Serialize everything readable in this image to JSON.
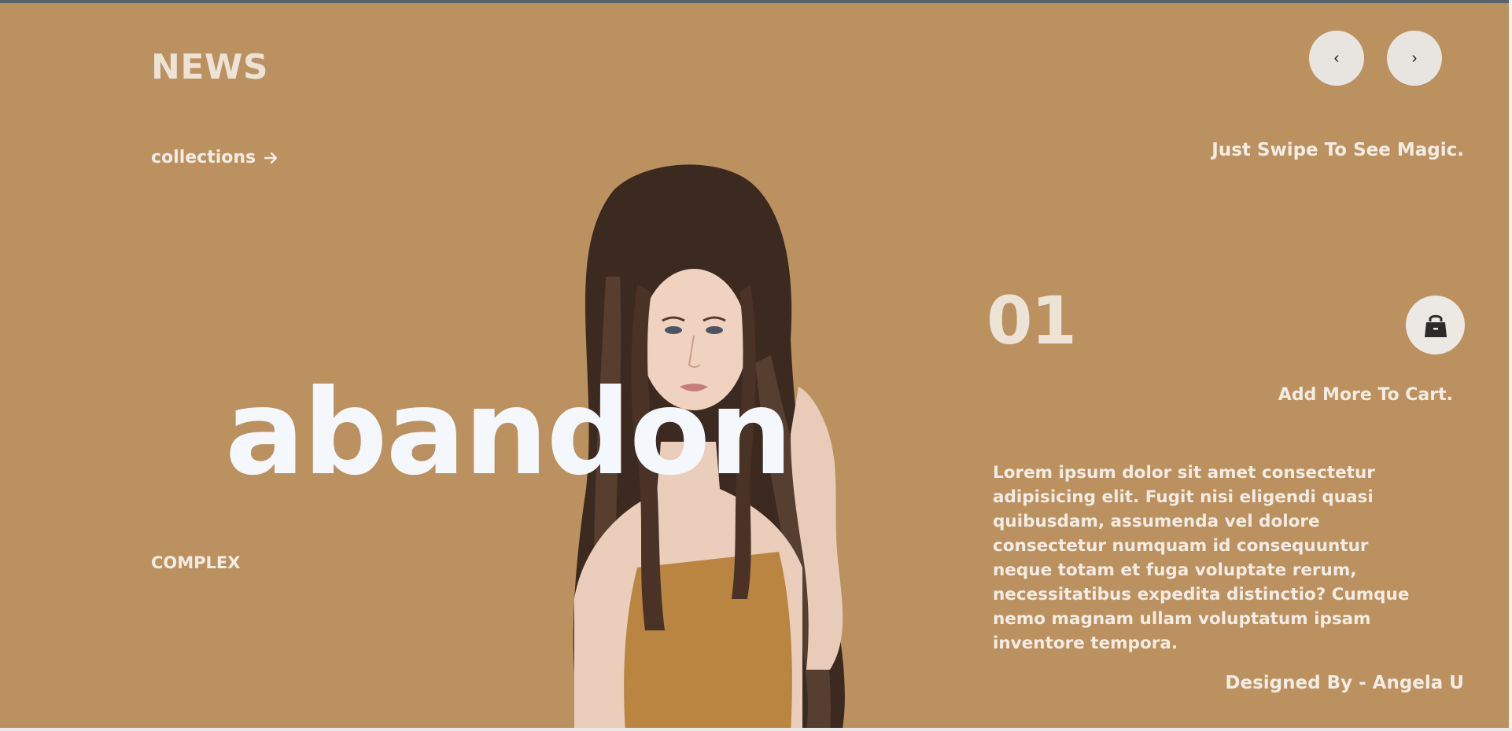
{
  "brand": {
    "title": "NEWS"
  },
  "nav": {
    "prev_label": "‹",
    "next_label": "›",
    "collections_label": "collections"
  },
  "hero": {
    "tagline": "Just Swipe To See Magic.",
    "headline": "abandon",
    "category": "COMPLEX",
    "slide_number": "01",
    "cart_text": "Add More To Cart.",
    "description": "Lorem ipsum dolor sit amet consectetur adipisicing elit. Fugit nisi eligendi quasi quibusdam, assumenda vel dolore consectetur numquam id consequuntur neque totam et fuga voluptate rerum, necessitatibus expedita distinctio? Cumque nemo magnam ullam voluptatum ipsam inventore tempora.",
    "credit": "Designed By - Angela U"
  },
  "icons": {
    "arrow": "arrow-right-icon",
    "cart": "shopping-bag-icon"
  },
  "colors": {
    "background": "#bb9160",
    "headline": "#f4f7fb",
    "text": "#f3ece4",
    "button": "#e8e4e0"
  }
}
